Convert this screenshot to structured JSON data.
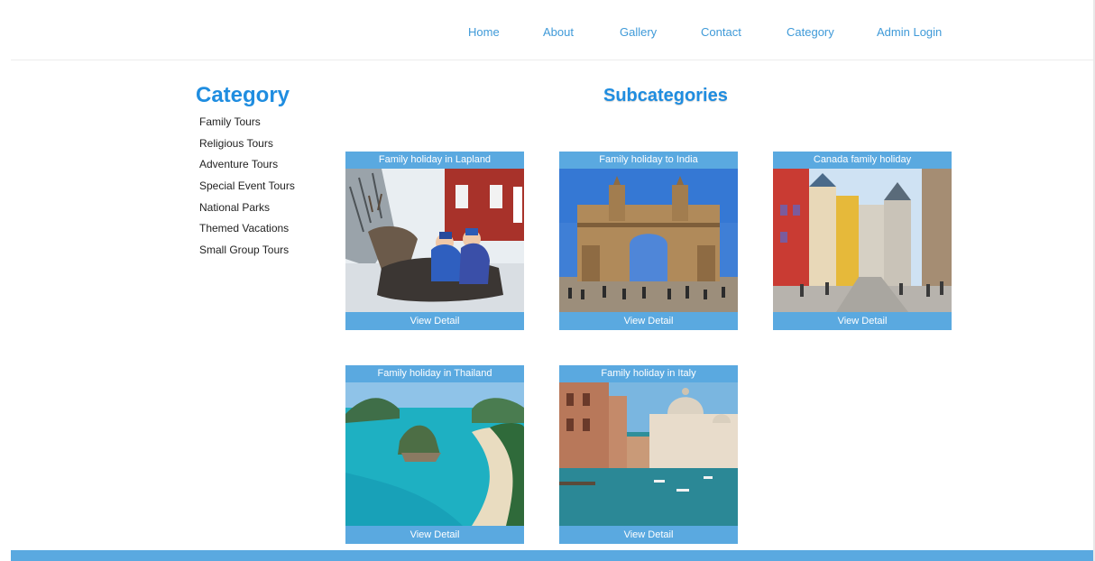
{
  "nav": {
    "items": [
      "Home",
      "About",
      "Gallery",
      "Contact",
      "Category",
      "Admin Login"
    ]
  },
  "sidebar": {
    "title": "Category",
    "items": [
      "Family Tours",
      "Religious Tours",
      "Adventure Tours",
      "Special Event Tours",
      "National Parks",
      "Themed Vacations",
      "Small Group Tours"
    ]
  },
  "main": {
    "title": "Subcategories",
    "cards": [
      {
        "title": "Family holiday in Lapland",
        "link": "View Detail"
      },
      {
        "title": "Family holiday to India",
        "link": "View Detail"
      },
      {
        "title": "Canada family holiday",
        "link": "View Detail"
      },
      {
        "title": "Family holiday in Thailand",
        "link": "View Detail"
      },
      {
        "title": "Family holiday in Italy",
        "link": "View Detail"
      }
    ]
  },
  "colors": {
    "accent": "#1f8de0",
    "nav_text": "#3f9ad8",
    "card_bar": "#5aa9e0"
  }
}
